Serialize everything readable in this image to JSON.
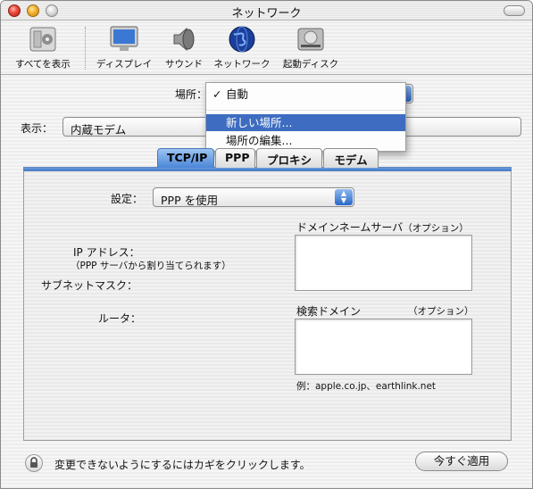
{
  "window": {
    "title": "ネットワーク"
  },
  "toolbar": {
    "items": [
      {
        "label": "すべてを表示",
        "icon": "apple-prefs-icon"
      },
      {
        "label": "ディスプレイ",
        "icon": "display-icon"
      },
      {
        "label": "サウンド",
        "icon": "speaker-icon"
      },
      {
        "label": "ネットワーク",
        "icon": "globe-icon"
      },
      {
        "label": "起動ディスク",
        "icon": "disk-icon"
      }
    ]
  },
  "location": {
    "label": "場所：",
    "menu_items": [
      {
        "label": "自動",
        "checked": true
      },
      {
        "label": "新しい場所...",
        "selected": true
      },
      {
        "label": "場所の編集..."
      }
    ]
  },
  "show": {
    "label": "表示：",
    "value": "内蔵モデム"
  },
  "tabs": [
    "TCP/IP",
    "PPP",
    "プロキシ",
    "モデム"
  ],
  "active_tab": "TCP/IP",
  "tcpip": {
    "config_label": "設定：",
    "config_value": "PPP を使用",
    "ip_label": "IP アドレス：",
    "ip_note": "（PPP サーバから割り当てられます）",
    "subnet_label": "サブネットマスク：",
    "router_label": "ルータ：",
    "dns_label": "ドメインネームサーバ",
    "dns_optional": "（オプション）",
    "search_label": "検索ドメイン",
    "search_optional": "（オプション）",
    "example": "例：apple.co.jp、earthlink.net"
  },
  "footer": {
    "lock_text": "変更できないようにするにはカギをクリックします。",
    "apply_label": "今すぐ適用"
  }
}
